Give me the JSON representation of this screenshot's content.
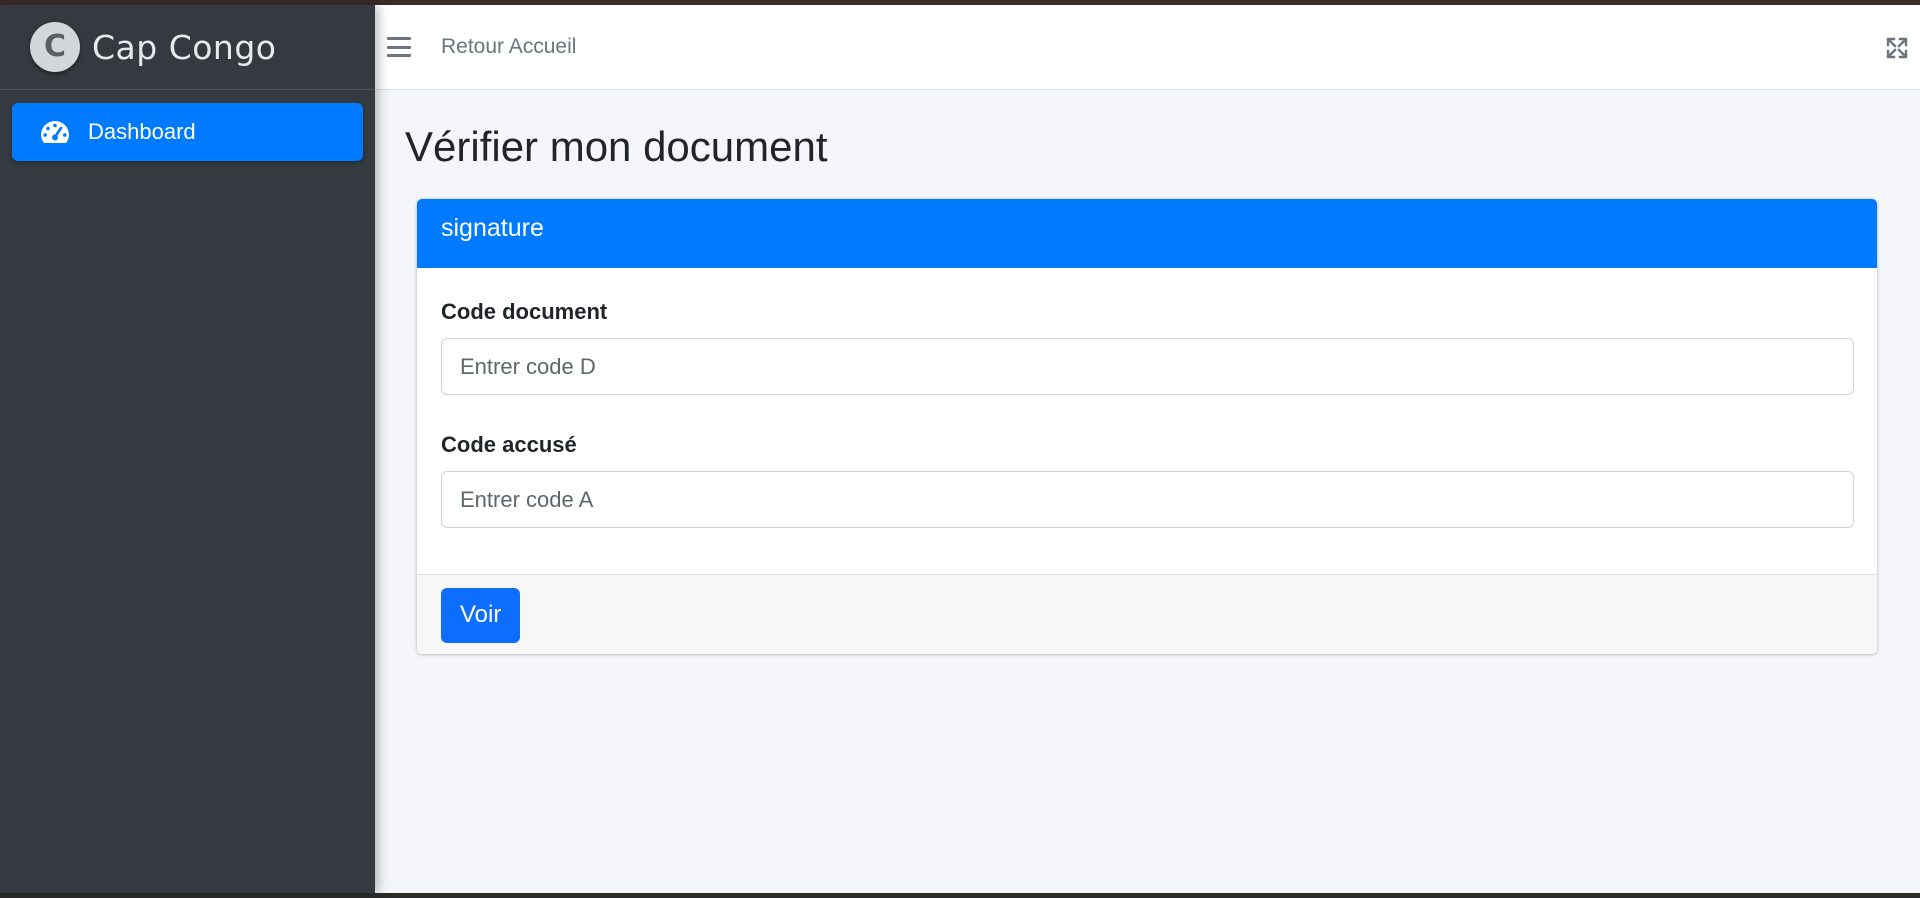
{
  "sidebar": {
    "brand": {
      "logo_letter": "C",
      "name": "Cap Congo"
    },
    "items": [
      {
        "label": "Dashboard",
        "icon": "tachometer-icon",
        "active": true
      }
    ]
  },
  "topbar": {
    "menu_icon": "hamburger-icon",
    "home_link": "Retour Accueil",
    "fullscreen_icon": "expand-icon"
  },
  "page": {
    "title": "Vérifier mon document"
  },
  "card": {
    "header": "signature",
    "fields": [
      {
        "label": "Code document",
        "placeholder": "Entrer code D",
        "value": ""
      },
      {
        "label": "Code accusé",
        "placeholder": "Entrer code A",
        "value": ""
      }
    ],
    "submit_label": "Voir"
  },
  "colors": {
    "primary": "#007bff",
    "button": "#0d6efd",
    "sidebar_bg": "#343a40",
    "content_bg": "#f4f6f9"
  }
}
